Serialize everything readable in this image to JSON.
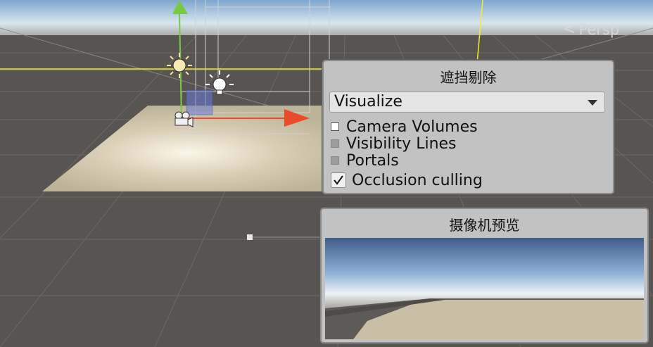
{
  "viewport": {
    "persp_label": "Persp"
  },
  "occlusion_panel": {
    "title": "遮挡剔除",
    "dropdown_value": "Visualize",
    "options": [
      {
        "label": "Camera Volumes",
        "enabled": true,
        "checked": false
      },
      {
        "label": "Visibility Lines",
        "enabled": false,
        "checked": false
      },
      {
        "label": "Portals",
        "enabled": false,
        "checked": false
      }
    ],
    "occlusion_culling_label": "Occlusion culling",
    "occlusion_culling_checked": true
  },
  "camera_preview": {
    "title": "摄像机预览"
  },
  "colors": {
    "panel_bg": "#c2c2c2",
    "ground": "#575451",
    "plane": "#c8bea4",
    "axis_y": "#7ac943",
    "axis_x": "#e94b2b",
    "yellow_line": "#f3ee2a"
  }
}
